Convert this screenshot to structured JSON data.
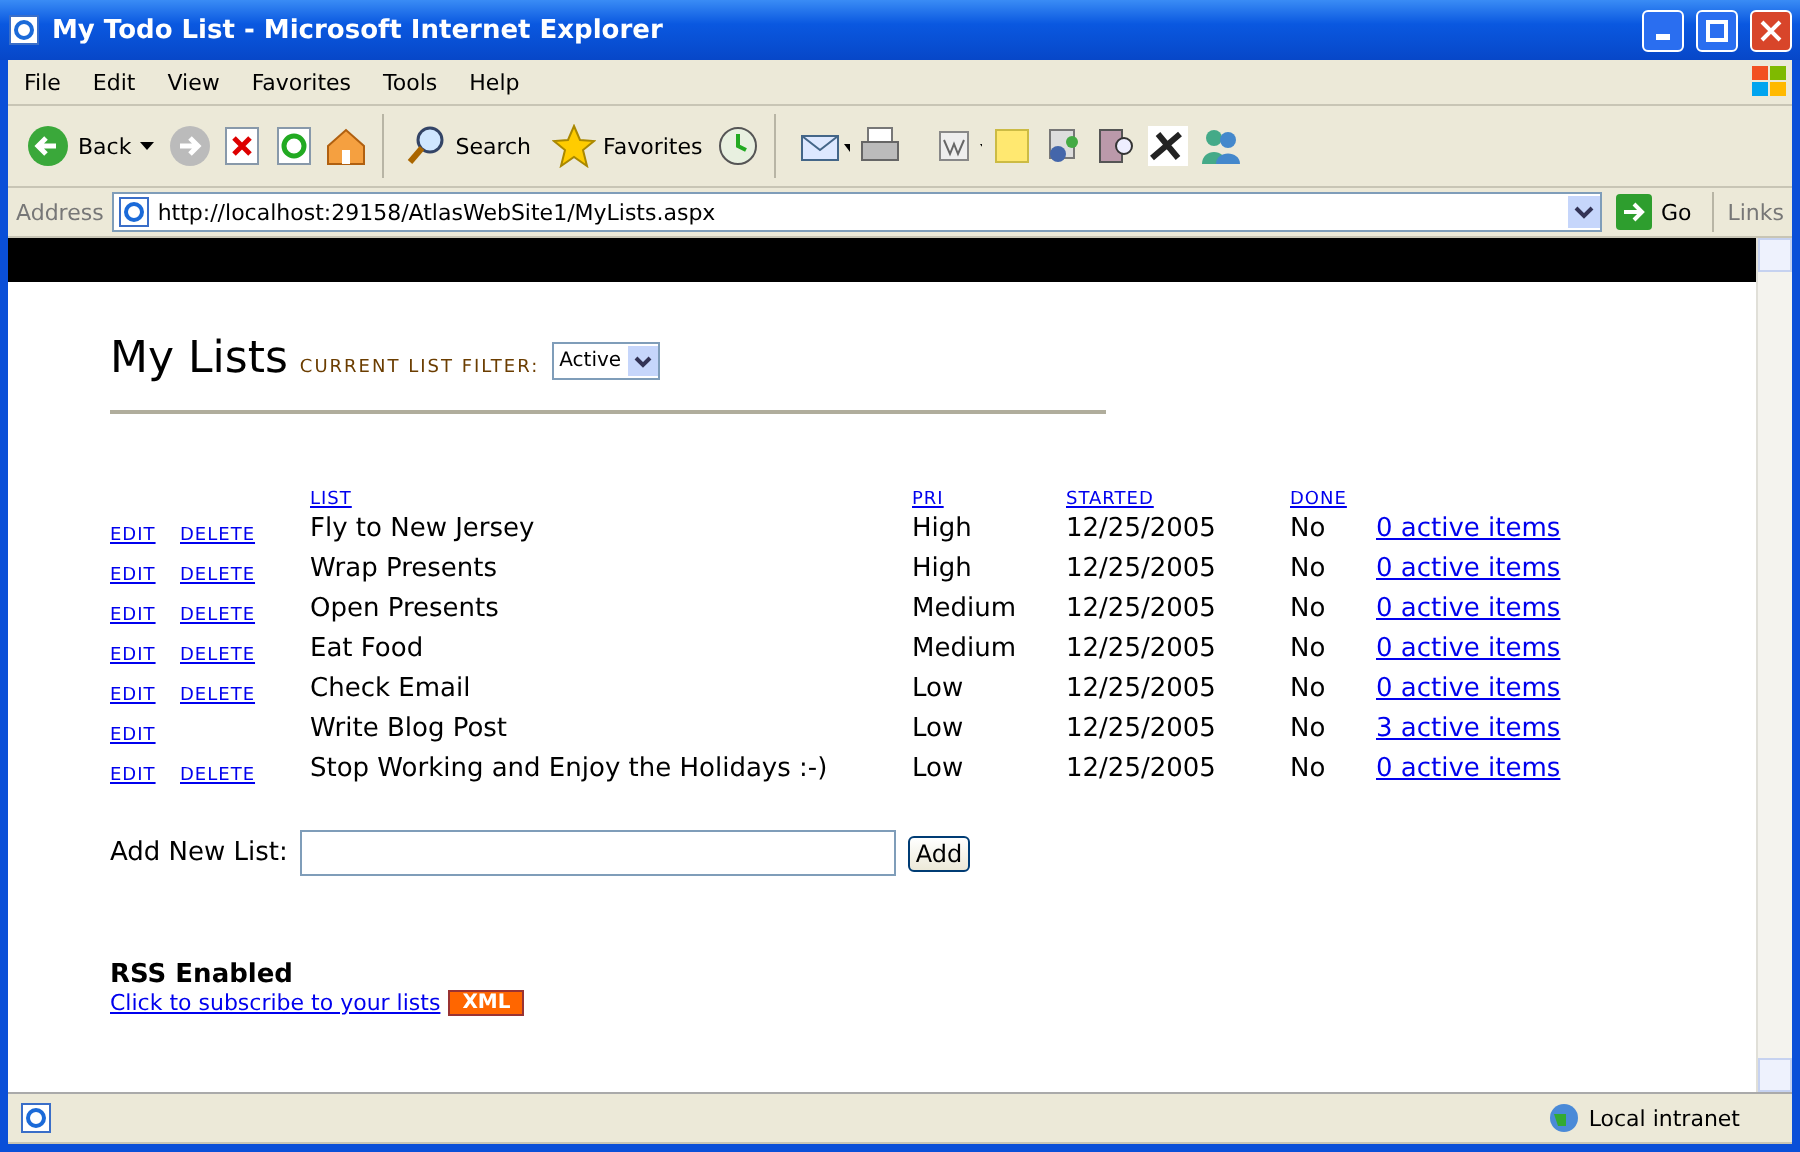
{
  "window": {
    "title": "My Todo List - Microsoft Internet Explorer"
  },
  "menu": [
    "File",
    "Edit",
    "View",
    "Favorites",
    "Tools",
    "Help"
  ],
  "toolbar": {
    "back": "Back",
    "search": "Search",
    "favorites": "Favorites"
  },
  "address_bar": {
    "label": "Address",
    "url": "http://localhost:29158/AtlasWebSite1/MyLists.aspx",
    "go": "Go",
    "links": "Links"
  },
  "page": {
    "heading": "My Lists",
    "filter_label": "CURRENT LIST FILTER:",
    "filter_value": "Active"
  },
  "table": {
    "columns": [
      "LIST",
      "PRI",
      "STARTED",
      "DONE"
    ],
    "rows": [
      {
        "edit": "EDIT",
        "delete": "DELETE",
        "list": "Fly to New Jersey",
        "pri": "High",
        "started": "12/25/2005",
        "done": "No",
        "items": "0 active items"
      },
      {
        "edit": "EDIT",
        "delete": "DELETE",
        "list": "Wrap Presents",
        "pri": "High",
        "started": "12/25/2005",
        "done": "No",
        "items": "0 active items"
      },
      {
        "edit": "EDIT",
        "delete": "DELETE",
        "list": "Open Presents",
        "pri": "Medium",
        "started": "12/25/2005",
        "done": "No",
        "items": "0 active items"
      },
      {
        "edit": "EDIT",
        "delete": "DELETE",
        "list": "Eat Food",
        "pri": "Medium",
        "started": "12/25/2005",
        "done": "No",
        "items": "0 active items"
      },
      {
        "edit": "EDIT",
        "delete": "DELETE",
        "list": "Check Email",
        "pri": "Low",
        "started": "12/25/2005",
        "done": "No",
        "items": "0 active items"
      },
      {
        "edit": "EDIT",
        "list": "Write Blog Post",
        "pri": "Low",
        "started": "12/25/2005",
        "done": "No",
        "items": "3 active items"
      },
      {
        "edit": "EDIT",
        "delete": "DELETE",
        "list": "Stop Working and Enjoy the Holidays :-)",
        "pri": "Low",
        "started": "12/25/2005",
        "done": "No",
        "items": "0 active items"
      }
    ]
  },
  "add_form": {
    "label": "Add New List:",
    "button": "Add"
  },
  "rss": {
    "heading": "RSS Enabled",
    "link": "Click to subscribe to your lists",
    "badge": "XML"
  },
  "status_bar": {
    "zone": "Local intranet"
  }
}
